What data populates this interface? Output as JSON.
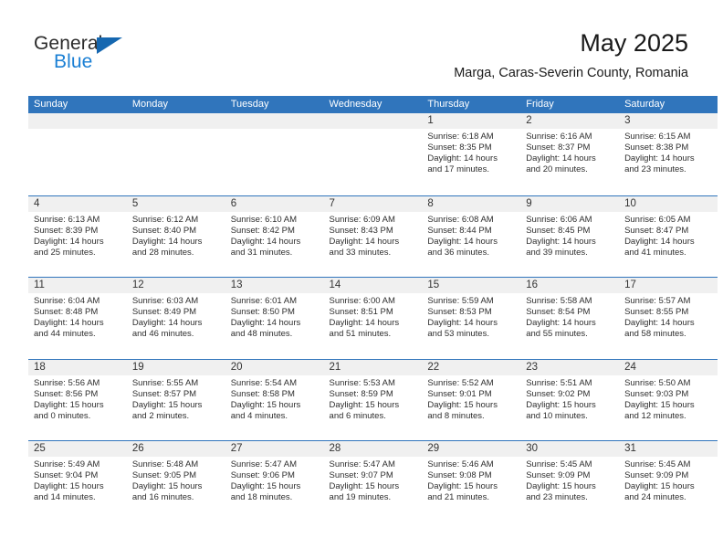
{
  "brand": {
    "name_part1": "General",
    "name_part2": "Blue",
    "color_dark": "#2b2b2b",
    "color_blue": "#1a7fd4"
  },
  "header": {
    "title": "May 2025",
    "subtitle": "Marga, Caras-Severin County, Romania"
  },
  "theme": {
    "header_blue": "#3075bc",
    "daynum_band": "#f0f0f0",
    "text": "#2e2e2e"
  },
  "weekday_headers": [
    "Sunday",
    "Monday",
    "Tuesday",
    "Wednesday",
    "Thursday",
    "Friday",
    "Saturday"
  ],
  "weeks": [
    [
      {
        "day": "",
        "empty": true
      },
      {
        "day": "",
        "empty": true
      },
      {
        "day": "",
        "empty": true
      },
      {
        "day": "",
        "empty": true
      },
      {
        "day": "1",
        "sunrise": "Sunrise: 6:18 AM",
        "sunset": "Sunset: 8:35 PM",
        "daylight1": "Daylight: 14 hours",
        "daylight2": "and 17 minutes."
      },
      {
        "day": "2",
        "sunrise": "Sunrise: 6:16 AM",
        "sunset": "Sunset: 8:37 PM",
        "daylight1": "Daylight: 14 hours",
        "daylight2": "and 20 minutes."
      },
      {
        "day": "3",
        "sunrise": "Sunrise: 6:15 AM",
        "sunset": "Sunset: 8:38 PM",
        "daylight1": "Daylight: 14 hours",
        "daylight2": "and 23 minutes."
      }
    ],
    [
      {
        "day": "4",
        "sunrise": "Sunrise: 6:13 AM",
        "sunset": "Sunset: 8:39 PM",
        "daylight1": "Daylight: 14 hours",
        "daylight2": "and 25 minutes."
      },
      {
        "day": "5",
        "sunrise": "Sunrise: 6:12 AM",
        "sunset": "Sunset: 8:40 PM",
        "daylight1": "Daylight: 14 hours",
        "daylight2": "and 28 minutes."
      },
      {
        "day": "6",
        "sunrise": "Sunrise: 6:10 AM",
        "sunset": "Sunset: 8:42 PM",
        "daylight1": "Daylight: 14 hours",
        "daylight2": "and 31 minutes."
      },
      {
        "day": "7",
        "sunrise": "Sunrise: 6:09 AM",
        "sunset": "Sunset: 8:43 PM",
        "daylight1": "Daylight: 14 hours",
        "daylight2": "and 33 minutes."
      },
      {
        "day": "8",
        "sunrise": "Sunrise: 6:08 AM",
        "sunset": "Sunset: 8:44 PM",
        "daylight1": "Daylight: 14 hours",
        "daylight2": "and 36 minutes."
      },
      {
        "day": "9",
        "sunrise": "Sunrise: 6:06 AM",
        "sunset": "Sunset: 8:45 PM",
        "daylight1": "Daylight: 14 hours",
        "daylight2": "and 39 minutes."
      },
      {
        "day": "10",
        "sunrise": "Sunrise: 6:05 AM",
        "sunset": "Sunset: 8:47 PM",
        "daylight1": "Daylight: 14 hours",
        "daylight2": "and 41 minutes."
      }
    ],
    [
      {
        "day": "11",
        "sunrise": "Sunrise: 6:04 AM",
        "sunset": "Sunset: 8:48 PM",
        "daylight1": "Daylight: 14 hours",
        "daylight2": "and 44 minutes."
      },
      {
        "day": "12",
        "sunrise": "Sunrise: 6:03 AM",
        "sunset": "Sunset: 8:49 PM",
        "daylight1": "Daylight: 14 hours",
        "daylight2": "and 46 minutes."
      },
      {
        "day": "13",
        "sunrise": "Sunrise: 6:01 AM",
        "sunset": "Sunset: 8:50 PM",
        "daylight1": "Daylight: 14 hours",
        "daylight2": "and 48 minutes."
      },
      {
        "day": "14",
        "sunrise": "Sunrise: 6:00 AM",
        "sunset": "Sunset: 8:51 PM",
        "daylight1": "Daylight: 14 hours",
        "daylight2": "and 51 minutes."
      },
      {
        "day": "15",
        "sunrise": "Sunrise: 5:59 AM",
        "sunset": "Sunset: 8:53 PM",
        "daylight1": "Daylight: 14 hours",
        "daylight2": "and 53 minutes."
      },
      {
        "day": "16",
        "sunrise": "Sunrise: 5:58 AM",
        "sunset": "Sunset: 8:54 PM",
        "daylight1": "Daylight: 14 hours",
        "daylight2": "and 55 minutes."
      },
      {
        "day": "17",
        "sunrise": "Sunrise: 5:57 AM",
        "sunset": "Sunset: 8:55 PM",
        "daylight1": "Daylight: 14 hours",
        "daylight2": "and 58 minutes."
      }
    ],
    [
      {
        "day": "18",
        "sunrise": "Sunrise: 5:56 AM",
        "sunset": "Sunset: 8:56 PM",
        "daylight1": "Daylight: 15 hours",
        "daylight2": "and 0 minutes."
      },
      {
        "day": "19",
        "sunrise": "Sunrise: 5:55 AM",
        "sunset": "Sunset: 8:57 PM",
        "daylight1": "Daylight: 15 hours",
        "daylight2": "and 2 minutes."
      },
      {
        "day": "20",
        "sunrise": "Sunrise: 5:54 AM",
        "sunset": "Sunset: 8:58 PM",
        "daylight1": "Daylight: 15 hours",
        "daylight2": "and 4 minutes."
      },
      {
        "day": "21",
        "sunrise": "Sunrise: 5:53 AM",
        "sunset": "Sunset: 8:59 PM",
        "daylight1": "Daylight: 15 hours",
        "daylight2": "and 6 minutes."
      },
      {
        "day": "22",
        "sunrise": "Sunrise: 5:52 AM",
        "sunset": "Sunset: 9:01 PM",
        "daylight1": "Daylight: 15 hours",
        "daylight2": "and 8 minutes."
      },
      {
        "day": "23",
        "sunrise": "Sunrise: 5:51 AM",
        "sunset": "Sunset: 9:02 PM",
        "daylight1": "Daylight: 15 hours",
        "daylight2": "and 10 minutes."
      },
      {
        "day": "24",
        "sunrise": "Sunrise: 5:50 AM",
        "sunset": "Sunset: 9:03 PM",
        "daylight1": "Daylight: 15 hours",
        "daylight2": "and 12 minutes."
      }
    ],
    [
      {
        "day": "25",
        "sunrise": "Sunrise: 5:49 AM",
        "sunset": "Sunset: 9:04 PM",
        "daylight1": "Daylight: 15 hours",
        "daylight2": "and 14 minutes."
      },
      {
        "day": "26",
        "sunrise": "Sunrise: 5:48 AM",
        "sunset": "Sunset: 9:05 PM",
        "daylight1": "Daylight: 15 hours",
        "daylight2": "and 16 minutes."
      },
      {
        "day": "27",
        "sunrise": "Sunrise: 5:47 AM",
        "sunset": "Sunset: 9:06 PM",
        "daylight1": "Daylight: 15 hours",
        "daylight2": "and 18 minutes."
      },
      {
        "day": "28",
        "sunrise": "Sunrise: 5:47 AM",
        "sunset": "Sunset: 9:07 PM",
        "daylight1": "Daylight: 15 hours",
        "daylight2": "and 19 minutes."
      },
      {
        "day": "29",
        "sunrise": "Sunrise: 5:46 AM",
        "sunset": "Sunset: 9:08 PM",
        "daylight1": "Daylight: 15 hours",
        "daylight2": "and 21 minutes."
      },
      {
        "day": "30",
        "sunrise": "Sunrise: 5:45 AM",
        "sunset": "Sunset: 9:09 PM",
        "daylight1": "Daylight: 15 hours",
        "daylight2": "and 23 minutes."
      },
      {
        "day": "31",
        "sunrise": "Sunrise: 5:45 AM",
        "sunset": "Sunset: 9:09 PM",
        "daylight1": "Daylight: 15 hours",
        "daylight2": "and 24 minutes."
      }
    ]
  ]
}
